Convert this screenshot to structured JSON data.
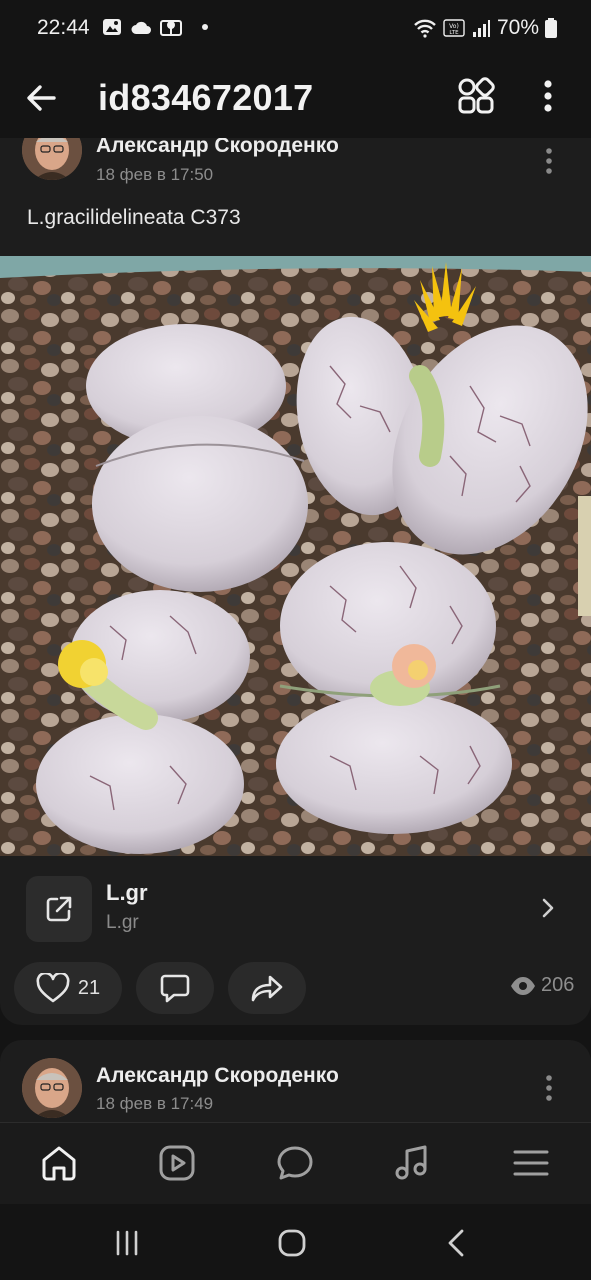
{
  "status_bar": {
    "time": "22:44",
    "battery": "70%",
    "icons": [
      "gallery-icon",
      "cloud-icon",
      "location-icon",
      "dot",
      "wifi-icon",
      "volte-icon",
      "signal-icon",
      "battery-icon"
    ]
  },
  "app_bar": {
    "title": "id834672017",
    "icons": [
      "back-arrow-icon",
      "grid-icon",
      "more-vertical-icon"
    ]
  },
  "post": {
    "author": "Александр Скороденко",
    "date": "18 фев в 17:50",
    "text": "L.gracilidelineata C373",
    "photo": {
      "subject": "lithops-plants-photo",
      "colors": {
        "pebbles": "#5a4637",
        "plant": "#d9d2d8",
        "flower": "#f2c21b"
      }
    },
    "link": {
      "title": "L.gr",
      "subtitle": "L.gr",
      "icon": "external-link-icon"
    },
    "likes": "21",
    "views": "206"
  },
  "next_post": {
    "author": "Александр Скороденко",
    "date": "18 фев в 17:49"
  },
  "bottom_nav": {
    "items": [
      {
        "id": "home",
        "icon": "home-icon",
        "active": true
      },
      {
        "id": "video",
        "icon": "video-icon",
        "active": false
      },
      {
        "id": "messages",
        "icon": "messages-icon",
        "active": false
      },
      {
        "id": "music",
        "icon": "music-icon",
        "active": false
      },
      {
        "id": "menu",
        "icon": "menu-icon",
        "active": false
      }
    ]
  },
  "system_nav": {
    "icons": [
      "recents-icon",
      "home-circle-icon",
      "back-chevron-icon"
    ]
  },
  "colors": {
    "background": "#141414",
    "card": "#1d1d1d",
    "pill": "#2a2a2a",
    "text": "#e6e6e6",
    "muted": "#8d8d8d"
  }
}
